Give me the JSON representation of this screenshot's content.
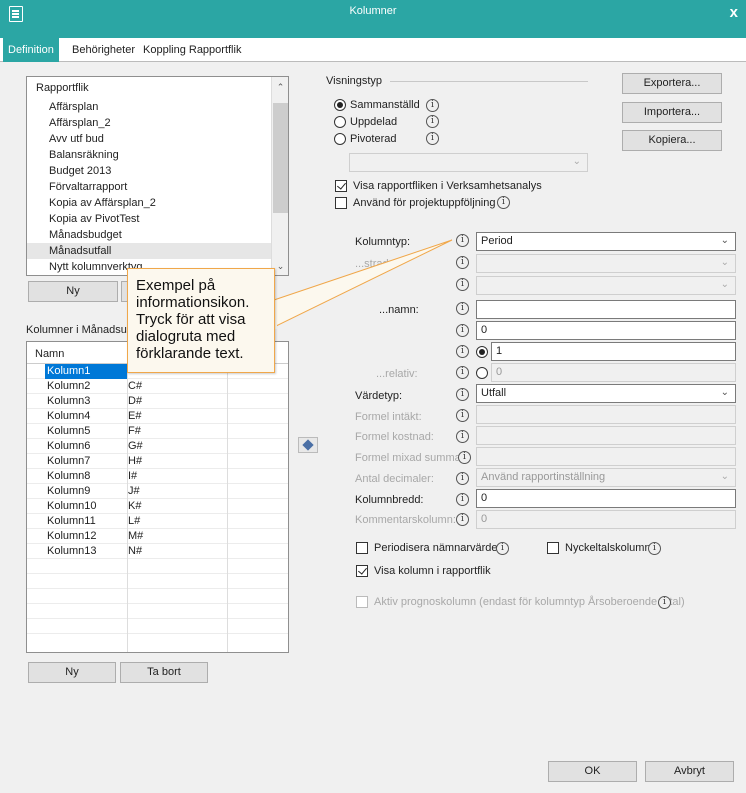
{
  "window": {
    "title": "Kolumner",
    "close": "x"
  },
  "tabs": [
    {
      "label": "Definition",
      "active": true
    },
    {
      "label": "Behörigheter",
      "active": false
    },
    {
      "label": "Koppling Rapportflik",
      "active": false
    }
  ],
  "rapportflik": {
    "header": "Rapportflik",
    "items": [
      "Affärsplan",
      "Affärsplan_2",
      "Avv utf bud",
      "Balansräkning",
      "Budget 2013",
      "Förvaltarrapport",
      "Kopia av Affärsplan_2",
      "Kopia av PivotTest",
      "Månadsbudget",
      "Månadsutfall",
      "Nytt kolumnverktyg"
    ],
    "selected_index": 9,
    "new_button": "Ny"
  },
  "kolumner": {
    "group_label": "Kolumner i Månadsutfa",
    "column_header": "Namn",
    "rows": [
      {
        "name": "Kolumn1",
        "code": ""
      },
      {
        "name": "Kolumn2",
        "code": "C#"
      },
      {
        "name": "Kolumn3",
        "code": "D#"
      },
      {
        "name": "Kolumn4",
        "code": "E#"
      },
      {
        "name": "Kolumn5",
        "code": "F#"
      },
      {
        "name": "Kolumn6",
        "code": "G#"
      },
      {
        "name": "Kolumn7",
        "code": "H#"
      },
      {
        "name": "Kolumn8",
        "code": "I#"
      },
      {
        "name": "Kolumn9",
        "code": "J#"
      },
      {
        "name": "Kolumn10",
        "code": "K#"
      },
      {
        "name": "Kolumn11",
        "code": "L#"
      },
      {
        "name": "Kolumn12",
        "code": "M#"
      },
      {
        "name": "Kolumn13",
        "code": "N#"
      }
    ],
    "new_button": "Ny",
    "delete_button": "Ta bort"
  },
  "visningstyp": {
    "group_label": "Visningstyp",
    "options": [
      {
        "label": "Sammanställd",
        "checked": true
      },
      {
        "label": "Uppdelad",
        "checked": false
      },
      {
        "label": "Pivoterad",
        "checked": false
      }
    ]
  },
  "actions": {
    "export": "Exportera...",
    "import": "Importera...",
    "copy": "Kopiera..."
  },
  "checks": {
    "visa_verksamhet": {
      "label": "Visa rapportfliken i Verksamhetsanalys",
      "checked": true
    },
    "projekt": {
      "label": "Använd för projektuppföljning",
      "checked": false
    }
  },
  "form": {
    "kolumntyp": {
      "label": "Kolumntyp:",
      "value": "Period"
    },
    "row2_label": "...strad:",
    "namn_label": "...namn:",
    "field3_value": "0",
    "field4_value": "1",
    "relativ_label": "...relativ:",
    "relativ_value": "0",
    "vardetyp": {
      "label": "Värdetyp:",
      "value": "Utfall"
    },
    "formel_intakt": "Formel intäkt:",
    "formel_kostnad": "Formel kostnad:",
    "formel_mixad": "Formel mixad summa:",
    "antal_decimaler": {
      "label": "Antal decimaler:",
      "value": "Använd rapportinställning"
    },
    "kolumnbredd": {
      "label": "Kolumnbredd:",
      "value": "0"
    },
    "kommentarskolumn": {
      "label": "Kommentarskolumn:",
      "value": "0"
    },
    "info_glyph": "i"
  },
  "bottom_checks": {
    "periodisera": {
      "label": "Periodisera nämnarvärden",
      "checked": false
    },
    "nyckeltal": {
      "label": "Nyckeltalskolumn",
      "checked": false
    },
    "visa_kolumn": {
      "label": "Visa kolumn i rapportflik",
      "checked": true
    },
    "aktiv_prognos": {
      "label": "Aktiv prognoskolumn (endast för kolumntyp Årsoberoende total)",
      "checked": false
    }
  },
  "callout": {
    "text": "Exempel på informationsikon. Tryck för att visa dialogruta med förklarande text."
  },
  "footer": {
    "ok": "OK",
    "cancel": "Avbryt"
  },
  "colors": {
    "titlebar": "#2ba6a4",
    "callout_border": "#f0a74a",
    "selection": "#0078d7"
  }
}
